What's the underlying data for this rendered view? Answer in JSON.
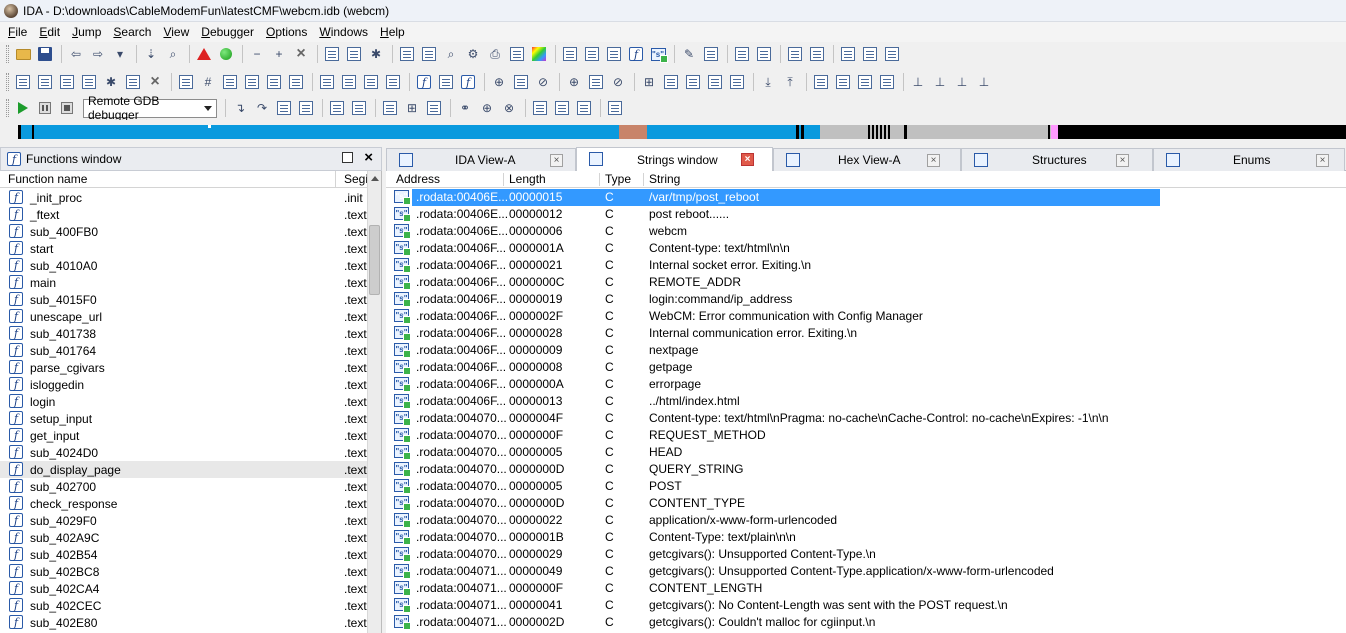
{
  "window": {
    "title": "IDA - D:\\downloads\\CableModemFun\\latestCMF\\webcm.idb (webcm)"
  },
  "menu": [
    {
      "label": "File",
      "key": "F",
      "rest": "ile"
    },
    {
      "label": "Edit",
      "key": "E",
      "rest": "dit"
    },
    {
      "label": "Jump",
      "key": "J",
      "rest": "ump"
    },
    {
      "label": "Search",
      "key": "S",
      "rest": "earch"
    },
    {
      "label": "View",
      "key": "V",
      "rest": "iew"
    },
    {
      "label": "Debugger",
      "key": "D",
      "rest": "ebugger"
    },
    {
      "label": "Options",
      "key": "O",
      "rest": "ptions"
    },
    {
      "label": "Windows",
      "key": "W",
      "rest": "indows"
    },
    {
      "label": "Help",
      "key": "H",
      "rest": "elp"
    }
  ],
  "toolbar": {
    "debugger_select": "Remote GDB debugger"
  },
  "nav_band": {
    "colors": {
      "code": "#0a9ade",
      "data": "#c0c0c0",
      "unexplored": "#000000",
      "extern": "#ff99ff",
      "lib": "#c8846a"
    }
  },
  "functions_window": {
    "title": "Functions window",
    "columns": {
      "name": "Function name",
      "segment": "Segi"
    },
    "selected_index": 16,
    "rows": [
      {
        "name": "_init_proc",
        "segment": ".init"
      },
      {
        "name": "_ftext",
        "segment": ".text"
      },
      {
        "name": "sub_400FB0",
        "segment": ".text"
      },
      {
        "name": "start",
        "segment": ".text"
      },
      {
        "name": "sub_4010A0",
        "segment": ".text"
      },
      {
        "name": "main",
        "segment": ".text"
      },
      {
        "name": "sub_4015F0",
        "segment": ".text"
      },
      {
        "name": "unescape_url",
        "segment": ".text"
      },
      {
        "name": "sub_401738",
        "segment": ".text"
      },
      {
        "name": "sub_401764",
        "segment": ".text"
      },
      {
        "name": "parse_cgivars",
        "segment": ".text"
      },
      {
        "name": "isloggedin",
        "segment": ".text"
      },
      {
        "name": "login",
        "segment": ".text"
      },
      {
        "name": "setup_input",
        "segment": ".text"
      },
      {
        "name": "get_input",
        "segment": ".text"
      },
      {
        "name": "sub_4024D0",
        "segment": ".text"
      },
      {
        "name": "do_display_page",
        "segment": ".text"
      },
      {
        "name": "sub_402700",
        "segment": ".text"
      },
      {
        "name": "check_response",
        "segment": ".text"
      },
      {
        "name": "sub_4029F0",
        "segment": ".text"
      },
      {
        "name": "sub_402A9C",
        "segment": ".text"
      },
      {
        "name": "sub_402B54",
        "segment": ".text"
      },
      {
        "name": "sub_402BC8",
        "segment": ".text"
      },
      {
        "name": "sub_402CA4",
        "segment": ".text"
      },
      {
        "name": "sub_402CEC",
        "segment": ".text"
      },
      {
        "name": "sub_402E80",
        "segment": ".text"
      }
    ]
  },
  "tabs": [
    {
      "label": "IDA View-A",
      "icon": "ida-view-icon",
      "active": false
    },
    {
      "label": "Strings window",
      "icon": "strings-icon",
      "active": true
    },
    {
      "label": "Hex View-A",
      "icon": "hex-view-icon",
      "active": false
    },
    {
      "label": "Structures",
      "icon": "structures-icon",
      "active": false
    },
    {
      "label": "Enums",
      "icon": "enums-icon",
      "active": false
    }
  ],
  "strings_window": {
    "columns": {
      "address": "Address",
      "length": "Length",
      "type": "Type",
      "string": "String"
    },
    "selected_index": 0,
    "rows": [
      {
        "address": ".rodata:00406E...",
        "length": "00000015",
        "type": "C",
        "string": "/var/tmp/post_reboot"
      },
      {
        "address": ".rodata:00406E...",
        "length": "00000012",
        "type": "C",
        "string": "post reboot......"
      },
      {
        "address": ".rodata:00406E...",
        "length": "00000006",
        "type": "C",
        "string": "webcm"
      },
      {
        "address": ".rodata:00406F...",
        "length": "0000001A",
        "type": "C",
        "string": "Content-type: text/html\\n\\n"
      },
      {
        "address": ".rodata:00406F...",
        "length": "00000021",
        "type": "C",
        "string": "Internal socket error. Exiting.\\n"
      },
      {
        "address": ".rodata:00406F...",
        "length": "0000000C",
        "type": "C",
        "string": "REMOTE_ADDR"
      },
      {
        "address": ".rodata:00406F...",
        "length": "00000019",
        "type": "C",
        "string": "login:command/ip_address"
      },
      {
        "address": ".rodata:00406F...",
        "length": "0000002F",
        "type": "C",
        "string": "WebCM: Error communication with Config Manager"
      },
      {
        "address": ".rodata:00406F...",
        "length": "00000028",
        "type": "C",
        "string": "Internal communication error. Exiting.\\n"
      },
      {
        "address": ".rodata:00406F...",
        "length": "00000009",
        "type": "C",
        "string": "nextpage"
      },
      {
        "address": ".rodata:00406F...",
        "length": "00000008",
        "type": "C",
        "string": "getpage"
      },
      {
        "address": ".rodata:00406F...",
        "length": "0000000A",
        "type": "C",
        "string": "errorpage"
      },
      {
        "address": ".rodata:00406F...",
        "length": "00000013",
        "type": "C",
        "string": "../html/index.html"
      },
      {
        "address": ".rodata:004070...",
        "length": "0000004F",
        "type": "C",
        "string": "Content-type: text/html\\nPragma: no-cache\\nCache-Control: no-cache\\nExpires: -1\\n\\n"
      },
      {
        "address": ".rodata:004070...",
        "length": "0000000F",
        "type": "C",
        "string": "REQUEST_METHOD"
      },
      {
        "address": ".rodata:004070...",
        "length": "00000005",
        "type": "C",
        "string": "HEAD"
      },
      {
        "address": ".rodata:004070...",
        "length": "0000000D",
        "type": "C",
        "string": "QUERY_STRING"
      },
      {
        "address": ".rodata:004070...",
        "length": "00000005",
        "type": "C",
        "string": "POST"
      },
      {
        "address": ".rodata:004070...",
        "length": "0000000D",
        "type": "C",
        "string": "CONTENT_TYPE"
      },
      {
        "address": ".rodata:004070...",
        "length": "00000022",
        "type": "C",
        "string": "application/x-www-form-urlencoded"
      },
      {
        "address": ".rodata:004070...",
        "length": "0000001B",
        "type": "C",
        "string": "Content-Type: text/plain\\n\\n"
      },
      {
        "address": ".rodata:004070...",
        "length": "00000029",
        "type": "C",
        "string": "getcgivars(): Unsupported Content-Type.\\n"
      },
      {
        "address": ".rodata:004071...",
        "length": "00000049",
        "type": "C",
        "string": "getcgivars(): Unsupported Content-Type.application/x-www-form-urlencoded"
      },
      {
        "address": ".rodata:004071...",
        "length": "0000000F",
        "type": "C",
        "string": "CONTENT_LENGTH"
      },
      {
        "address": ".rodata:004071...",
        "length": "00000041",
        "type": "C",
        "string": "getcgivars(): No Content-Length was sent with the POST request.\\n"
      },
      {
        "address": ".rodata:004071...",
        "length": "0000002D",
        "type": "C",
        "string": "getcgivars(): Couldn't malloc for cgiinput.\\n"
      }
    ]
  }
}
